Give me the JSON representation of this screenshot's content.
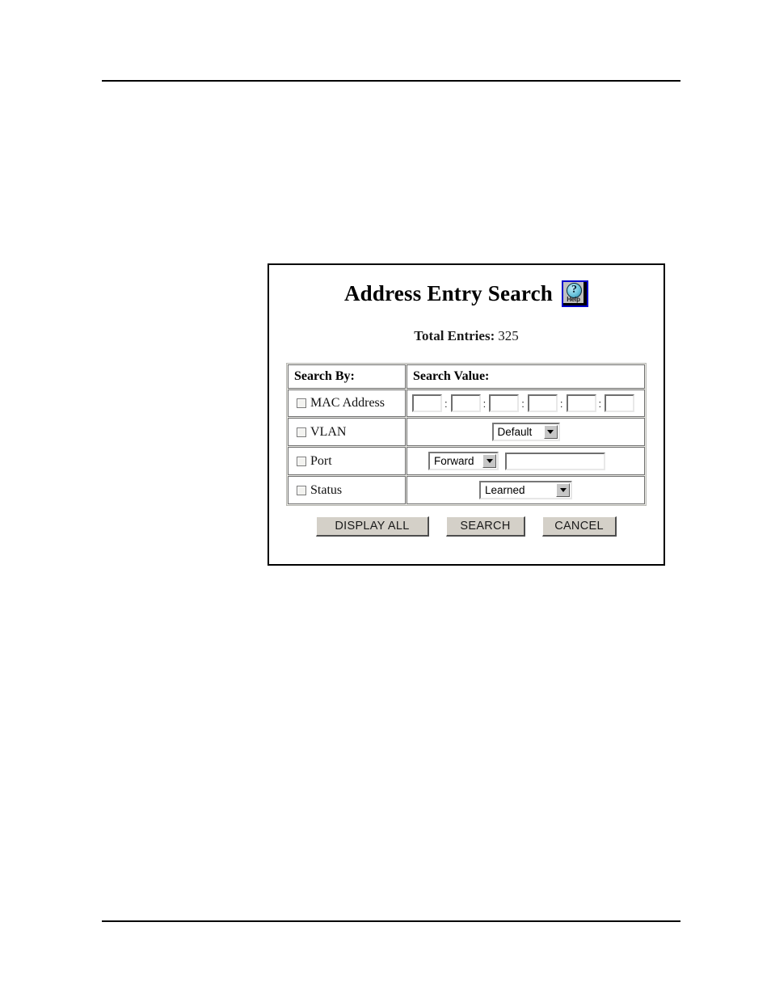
{
  "page": {
    "header_rule": true,
    "footer_rule": true
  },
  "dialog": {
    "title": "Address Entry Search",
    "help_icon": {
      "name": "help-icon",
      "label": "Help",
      "glyph": "?",
      "border_color": "#0000cc",
      "face_color": "#c0c0c0",
      "bubble_color": "#6cc5dd"
    },
    "total_entries": {
      "label": "Total Entries:",
      "value": "325"
    },
    "table": {
      "headers": {
        "search_by": "Search By:",
        "search_value": "Search Value:"
      },
      "rows": [
        {
          "id": "mac-address",
          "label": "MAC Address",
          "checked": false,
          "value_type": "mac-octets",
          "octets": [
            "",
            "",
            "",
            "",
            "",
            ""
          ],
          "separator": ":"
        },
        {
          "id": "vlan",
          "label": "VLAN",
          "checked": false,
          "value_type": "select",
          "selected": "Default",
          "options": [
            "Default"
          ]
        },
        {
          "id": "port",
          "label": "Port",
          "checked": false,
          "value_type": "select-and-text",
          "selected": "Forward",
          "options": [
            "Forward"
          ],
          "text_value": ""
        },
        {
          "id": "status",
          "label": "Status",
          "checked": false,
          "value_type": "select",
          "selected": "Learned",
          "options": [
            "Learned"
          ]
        }
      ]
    },
    "buttons": {
      "display_all": "DISPLAY ALL",
      "search": "SEARCH",
      "cancel": "CANCEL"
    }
  }
}
